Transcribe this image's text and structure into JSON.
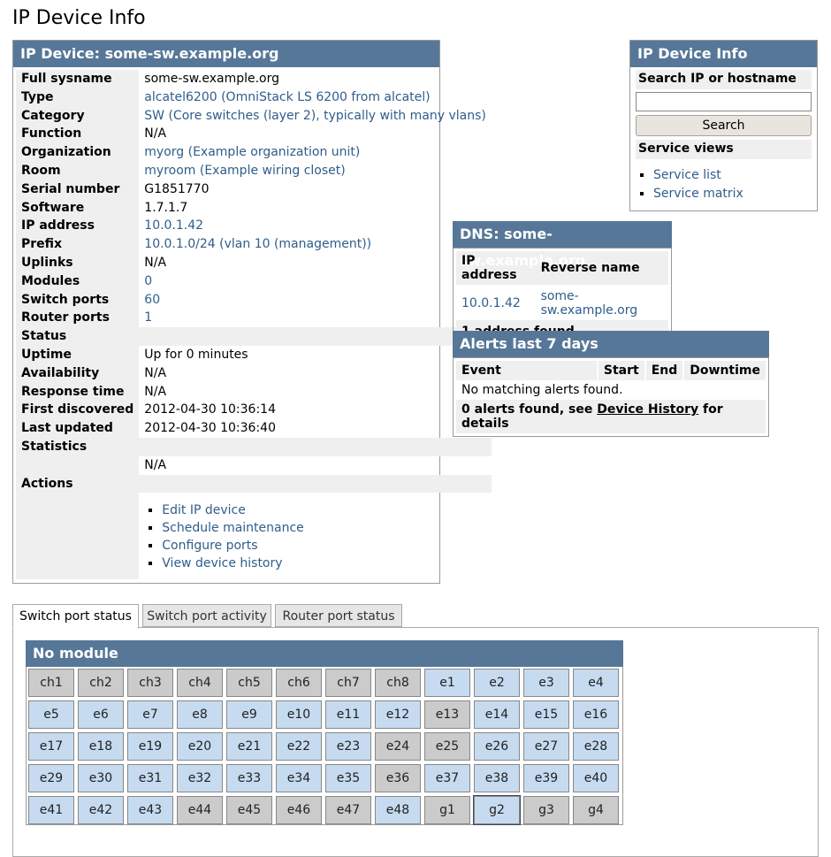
{
  "page_title": "IP Device Info",
  "ipdevice": {
    "header": "IP Device: some-sw.example.org",
    "rows": [
      {
        "key": "Full sysname",
        "value": "some-sw.example.org",
        "link": false
      },
      {
        "key": "Type",
        "value": "alcatel6200 (OmniStack LS 6200 from alcatel)",
        "link": true
      },
      {
        "key": "Category",
        "value": "SW (Core switches (layer 2), typically with many vlans)",
        "link": true
      },
      {
        "key": "Function",
        "value": "N/A",
        "link": false
      },
      {
        "key": "Organization",
        "value": "myorg (Example organization unit)",
        "link": true
      },
      {
        "key": "Room",
        "value": "myroom (Example wiring closet)",
        "link": true
      },
      {
        "key": "Serial number",
        "value": "G1851770",
        "link": false
      },
      {
        "key": "Software",
        "value": "1.7.1.7",
        "link": false
      },
      {
        "key": "IP address",
        "value": "10.0.1.42",
        "link": true
      },
      {
        "key": "Prefix",
        "value": "10.0.1.0/24 (vlan 10 (management))",
        "link": true
      },
      {
        "key": "Uplinks",
        "value": "N/A",
        "link": false
      },
      {
        "key": "Modules",
        "value": "0",
        "link": true
      },
      {
        "key": "Switch ports",
        "value": "60",
        "link": true
      },
      {
        "key": "Router ports",
        "value": "1",
        "link": true
      }
    ],
    "status_label": "Status",
    "status_rows": [
      {
        "key": "Uptime",
        "value": "Up for 0 minutes"
      },
      {
        "key": "Availability",
        "value": "N/A"
      },
      {
        "key": "Response time",
        "value": "N/A"
      },
      {
        "key": "First discovered",
        "value": "2012-04-30 10:36:14"
      },
      {
        "key": "Last updated",
        "value": "2012-04-30 10:36:40"
      }
    ],
    "statistics_label": "Statistics",
    "statistics_value": "N/A",
    "actions_label": "Actions",
    "actions": [
      "Edit IP device",
      "Schedule maintenance",
      "Configure ports",
      "View device history"
    ]
  },
  "sidebar": {
    "header": "IP Device Info",
    "search_label": "Search IP or hostname",
    "search_value": "",
    "search_button": "Search",
    "service_views_label": "Service views",
    "service_links": [
      "Service list",
      "Service matrix"
    ]
  },
  "dns": {
    "header": "DNS: some-sw.example.org",
    "col_ip": "IP address",
    "col_rev": "Reverse name",
    "ip": "10.0.1.42",
    "rev": "some-sw.example.org",
    "footer": "1 address found"
  },
  "alerts": {
    "header": "Alerts last 7 days",
    "columns": [
      "Event",
      "Start",
      "End",
      "Downtime"
    ],
    "empty_text": "No matching alerts found.",
    "footer_prefix": "0 alerts found, see ",
    "footer_link": "Device History",
    "footer_suffix": " for details"
  },
  "tabs": [
    "Switch port status",
    "Switch port activity",
    "Router port status"
  ],
  "module": {
    "header": "No module",
    "ports": [
      {
        "name": "ch1",
        "state": "down"
      },
      {
        "name": "ch2",
        "state": "down"
      },
      {
        "name": "ch3",
        "state": "down"
      },
      {
        "name": "ch4",
        "state": "down"
      },
      {
        "name": "ch5",
        "state": "down"
      },
      {
        "name": "ch6",
        "state": "down"
      },
      {
        "name": "ch7",
        "state": "down"
      },
      {
        "name": "ch8",
        "state": "down"
      },
      {
        "name": "e1",
        "state": "up"
      },
      {
        "name": "e2",
        "state": "up"
      },
      {
        "name": "e3",
        "state": "up"
      },
      {
        "name": "e4",
        "state": "up"
      },
      {
        "name": "e5",
        "state": "up"
      },
      {
        "name": "e6",
        "state": "up"
      },
      {
        "name": "e7",
        "state": "up"
      },
      {
        "name": "e8",
        "state": "up"
      },
      {
        "name": "e9",
        "state": "up"
      },
      {
        "name": "e10",
        "state": "up"
      },
      {
        "name": "e11",
        "state": "up"
      },
      {
        "name": "e12",
        "state": "up"
      },
      {
        "name": "e13",
        "state": "down"
      },
      {
        "name": "e14",
        "state": "up"
      },
      {
        "name": "e15",
        "state": "up"
      },
      {
        "name": "e16",
        "state": "up"
      },
      {
        "name": "e17",
        "state": "up"
      },
      {
        "name": "e18",
        "state": "up"
      },
      {
        "name": "e19",
        "state": "up"
      },
      {
        "name": "e20",
        "state": "up"
      },
      {
        "name": "e21",
        "state": "up"
      },
      {
        "name": "e22",
        "state": "up"
      },
      {
        "name": "e23",
        "state": "up"
      },
      {
        "name": "e24",
        "state": "down"
      },
      {
        "name": "e25",
        "state": "down"
      },
      {
        "name": "e26",
        "state": "up"
      },
      {
        "name": "e27",
        "state": "up"
      },
      {
        "name": "e28",
        "state": "up"
      },
      {
        "name": "e29",
        "state": "up"
      },
      {
        "name": "e30",
        "state": "up"
      },
      {
        "name": "e31",
        "state": "up"
      },
      {
        "name": "e32",
        "state": "up"
      },
      {
        "name": "e33",
        "state": "up"
      },
      {
        "name": "e34",
        "state": "up"
      },
      {
        "name": "e35",
        "state": "up"
      },
      {
        "name": "e36",
        "state": "down"
      },
      {
        "name": "e37",
        "state": "up"
      },
      {
        "name": "e38",
        "state": "up"
      },
      {
        "name": "e39",
        "state": "up"
      },
      {
        "name": "e40",
        "state": "up"
      },
      {
        "name": "e41",
        "state": "up"
      },
      {
        "name": "e42",
        "state": "up"
      },
      {
        "name": "e43",
        "state": "up"
      },
      {
        "name": "e44",
        "state": "down"
      },
      {
        "name": "e45",
        "state": "down"
      },
      {
        "name": "e46",
        "state": "down"
      },
      {
        "name": "e47",
        "state": "down"
      },
      {
        "name": "e48",
        "state": "up"
      },
      {
        "name": "g1",
        "state": "down"
      },
      {
        "name": "g2",
        "state": "up",
        "selected": true
      },
      {
        "name": "g3",
        "state": "down"
      },
      {
        "name": "g4",
        "state": "down"
      }
    ]
  },
  "colors": {
    "header_bg": "#567798",
    "link": "#2f5d8c",
    "port_up": "#c6dbf0",
    "port_down": "#cbcbcb"
  }
}
